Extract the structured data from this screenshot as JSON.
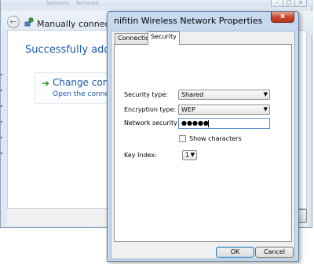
{
  "background_window": {
    "title": "Manually connect to a wirel",
    "heading": "Successfully added nifiti",
    "change_option": {
      "title": "Change connecti",
      "description": "Open the connection"
    },
    "top_tabs": [
      "Network",
      "Network"
    ]
  },
  "dialog": {
    "title": "nifitin Wireless Network Properties",
    "close_glyph": "x",
    "tabs": [
      {
        "label": "Connection",
        "active": false
      },
      {
        "label": "Security",
        "active": true
      }
    ],
    "security": {
      "security_type_label": "Security type:",
      "security_type_value": "Shared",
      "encryption_type_label": "Encryption type:",
      "encryption_type_value": "WEP",
      "network_key_label": "Network security key",
      "network_key_value": "●●●●●",
      "show_characters_label": "Show characters",
      "show_characters_checked": false,
      "key_index_label": "Key Index:",
      "key_index_value": "1"
    },
    "buttons": {
      "ok": "OK",
      "cancel": "Cancel"
    }
  },
  "colors": {
    "link_blue": "#1e5aa8",
    "dialog_frame": "#c6d9ef",
    "close_red": "#c8452b"
  }
}
